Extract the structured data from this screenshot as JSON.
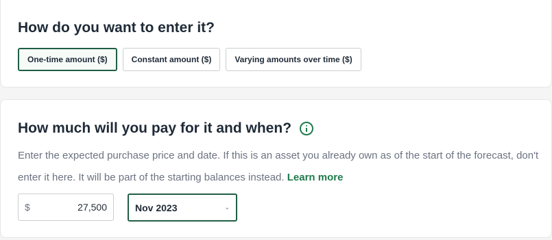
{
  "entry_method": {
    "heading": "How do you want to enter it?",
    "options": [
      {
        "label": "One-time amount ($)",
        "selected": true
      },
      {
        "label": "Constant amount ($)",
        "selected": false
      },
      {
        "label": "Varying amounts over time ($)",
        "selected": false
      }
    ]
  },
  "purchase": {
    "heading": "How much will you pay for it and when?",
    "info_icon": "info-circle-icon",
    "description": "Enter the expected purchase price and date. If this is an asset you already own as of the start of the forecast, don't enter it here. It will be part of the starting balances instead.",
    "learn_more": "Learn more",
    "currency_symbol": "$",
    "amount": "27,500",
    "date": "Nov 2023",
    "date_chevron_icon": "chevron-down-icon"
  },
  "colors": {
    "accent": "#1f7a4c",
    "selected_border": "#1f5e45"
  }
}
